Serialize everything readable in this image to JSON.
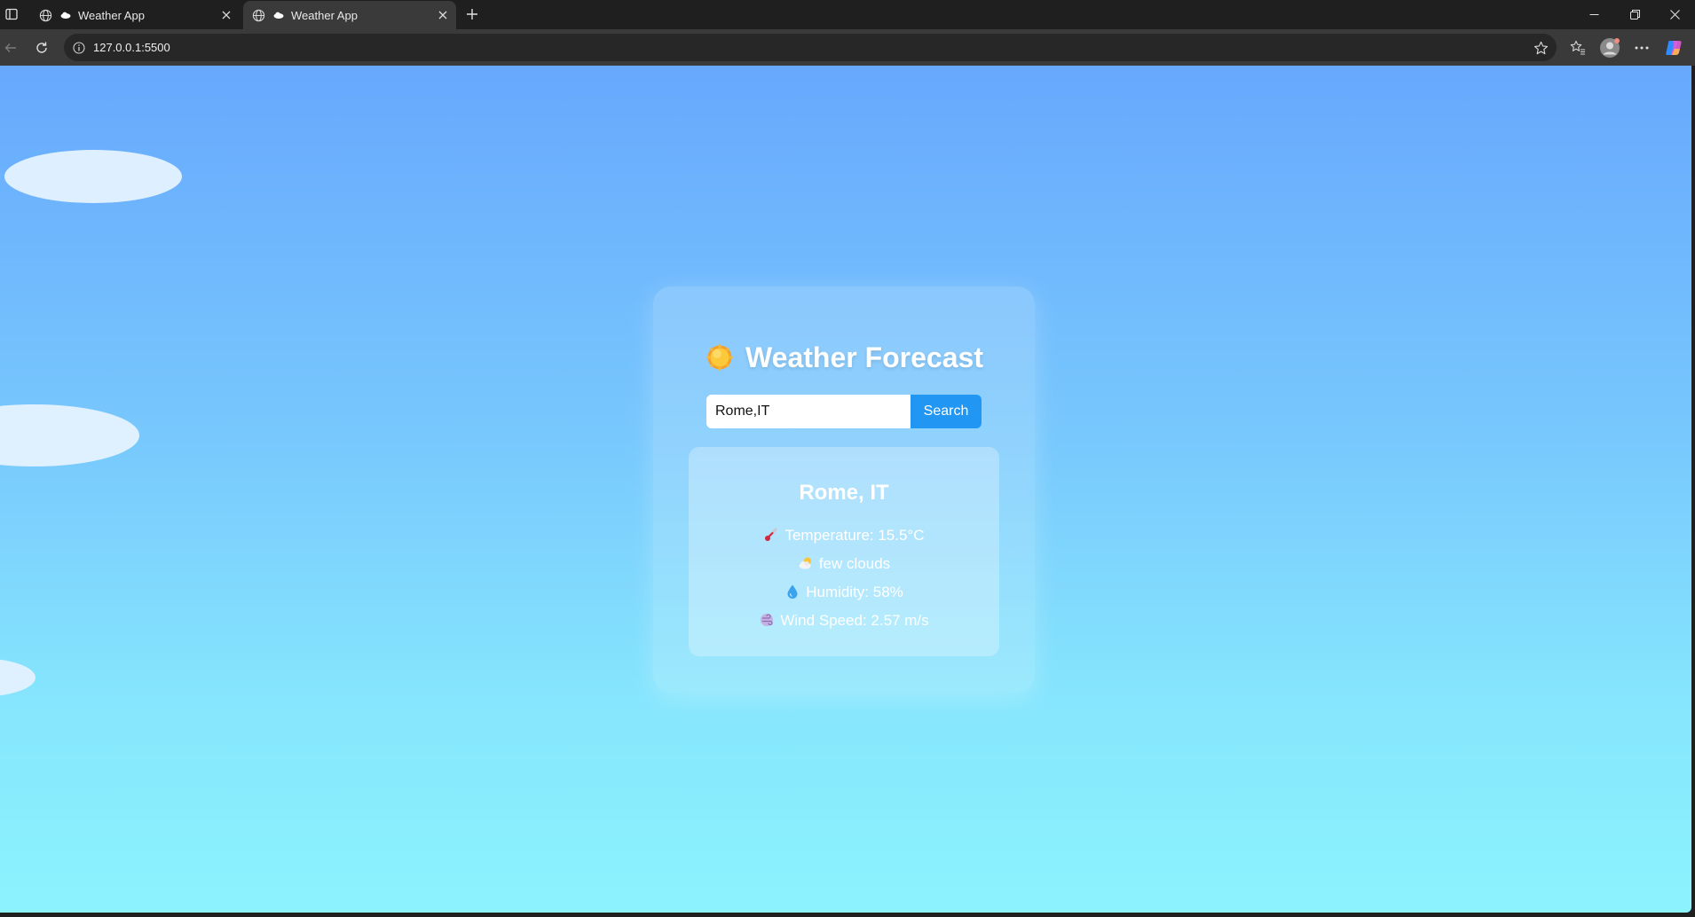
{
  "browser": {
    "tabs": [
      {
        "title": "Weather App"
      },
      {
        "title": "Weather App"
      }
    ],
    "url": "127.0.0.1:5500"
  },
  "app": {
    "title": "Weather Forecast",
    "search": {
      "value": "Rome,IT",
      "button_label": "Search"
    },
    "result": {
      "city": "Rome, IT",
      "temperature": "Temperature: 15.5°C",
      "description": "few clouds",
      "humidity": "Humidity: 58%",
      "wind": "Wind Speed: 2.57 m/s"
    }
  },
  "colors": {
    "button": "#2196f3",
    "gradient_top": "#67a8fd",
    "gradient_bottom": "#8cf3fd"
  },
  "icons": [
    "sun-icon",
    "thermometer-icon",
    "cloud-sun-icon",
    "droplet-icon",
    "wind-icon"
  ]
}
